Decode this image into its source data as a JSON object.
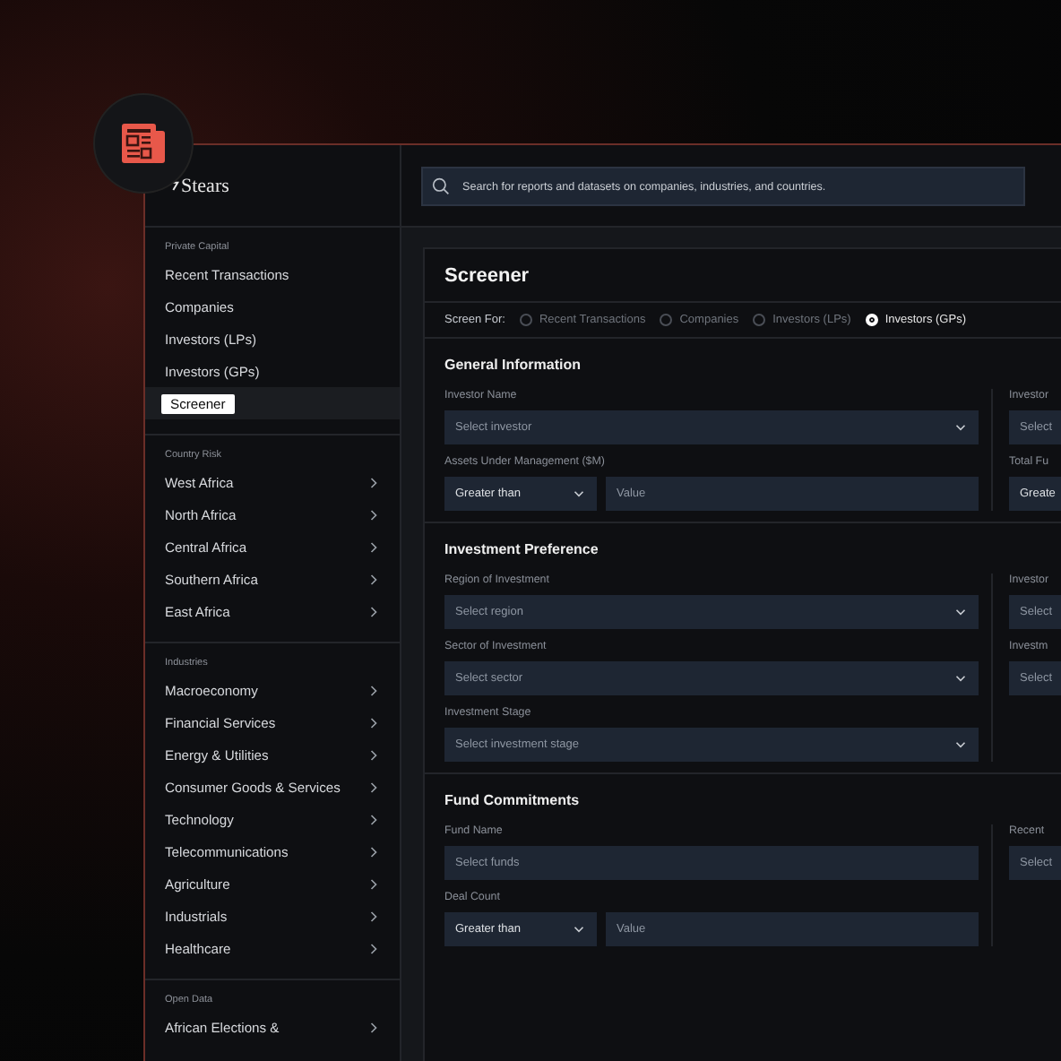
{
  "brand": {
    "name": "Stears"
  },
  "search": {
    "placeholder": "Search for reports and datasets on companies, industries, and countries."
  },
  "sidebar": {
    "sections": [
      {
        "title": "Private Capital",
        "items": [
          {
            "label": "Recent Transactions",
            "selected": false,
            "submenu": false
          },
          {
            "label": "Companies",
            "selected": false,
            "submenu": false
          },
          {
            "label": "Investors (LPs)",
            "selected": false,
            "submenu": false
          },
          {
            "label": "Investors (GPs)",
            "selected": false,
            "submenu": false
          },
          {
            "label": "Screener",
            "selected": true,
            "submenu": false
          }
        ]
      },
      {
        "title": "Country Risk",
        "items": [
          {
            "label": "West Africa",
            "selected": false,
            "submenu": true
          },
          {
            "label": "North Africa",
            "selected": false,
            "submenu": true
          },
          {
            "label": "Central Africa",
            "selected": false,
            "submenu": true
          },
          {
            "label": "Southern Africa",
            "selected": false,
            "submenu": true
          },
          {
            "label": "East Africa",
            "selected": false,
            "submenu": true
          }
        ]
      },
      {
        "title": "Industries",
        "items": [
          {
            "label": "Macroeconomy",
            "selected": false,
            "submenu": true
          },
          {
            "label": "Financial Services",
            "selected": false,
            "submenu": true
          },
          {
            "label": "Energy & Utilities",
            "selected": false,
            "submenu": true
          },
          {
            "label": "Consumer Goods & Services",
            "selected": false,
            "submenu": true
          },
          {
            "label": "Technology",
            "selected": false,
            "submenu": true
          },
          {
            "label": "Telecommunications",
            "selected": false,
            "submenu": true
          },
          {
            "label": "Agriculture",
            "selected": false,
            "submenu": true
          },
          {
            "label": "Industrials",
            "selected": false,
            "submenu": true
          },
          {
            "label": "Healthcare",
            "selected": false,
            "submenu": true
          }
        ]
      },
      {
        "title": "Open Data",
        "items": [
          {
            "label": "African Elections &",
            "selected": false,
            "submenu": true
          }
        ]
      }
    ]
  },
  "screener": {
    "title": "Screener",
    "screen_for_label": "Screen For:",
    "options": [
      {
        "label": "Recent Transactions",
        "selected": false
      },
      {
        "label": "Companies",
        "selected": false
      },
      {
        "label": "Investors (LPs)",
        "selected": false
      },
      {
        "label": "Investors (GPs)",
        "selected": true
      }
    ],
    "sections": [
      {
        "title": "General Information",
        "left": [
          {
            "kind": "select",
            "label": "Investor Name",
            "placeholder": "Select investor"
          },
          {
            "kind": "compare",
            "label": "Assets Under Management ($M)",
            "operator": "Greater than",
            "placeholder": "Value"
          }
        ],
        "right": [
          {
            "label": "Investor",
            "placeholder": "Select"
          },
          {
            "label": "Total Fu",
            "value": "Greate"
          }
        ]
      },
      {
        "title": "Investment Preference",
        "left": [
          {
            "kind": "select",
            "label": "Region of Investment",
            "placeholder": "Select region"
          },
          {
            "kind": "select",
            "label": "Sector of Investment",
            "placeholder": "Select sector"
          },
          {
            "kind": "select",
            "label": "Investment Stage",
            "placeholder": "Select investment stage"
          }
        ],
        "right": [
          {
            "label": "Investor",
            "placeholder": "Select"
          },
          {
            "label": "Investm",
            "placeholder": "Select"
          }
        ]
      },
      {
        "title": "Fund Commitments",
        "left": [
          {
            "kind": "input",
            "label": "Fund Name",
            "placeholder": "Select funds"
          },
          {
            "kind": "compare",
            "label": "Deal Count",
            "operator": "Greater than",
            "placeholder": "Value"
          }
        ],
        "right": [
          {
            "label": "Recent",
            "placeholder": "Select"
          }
        ]
      }
    ]
  }
}
